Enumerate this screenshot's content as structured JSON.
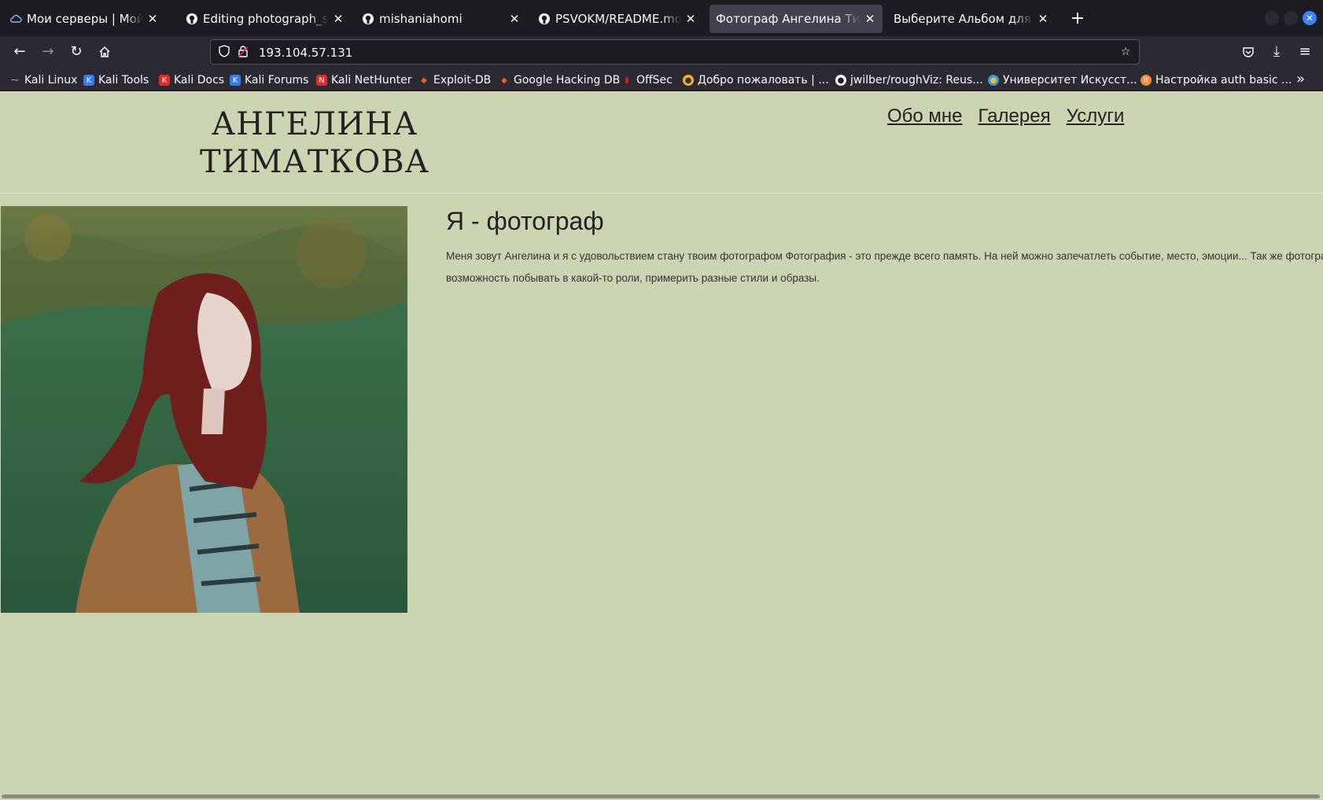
{
  "tabs": [
    {
      "title": "Мои серверы | Мой аккаунт",
      "icon": "cloud-icon"
    },
    {
      "title": "Editing photograph_site/README.md",
      "icon": "github-icon"
    },
    {
      "title": "mishaniahomi",
      "icon": "github-icon"
    },
    {
      "title": "PSVOKM/README.md at main",
      "icon": "github-icon"
    },
    {
      "title": "Фотограф Ангелина Тиматкова",
      "icon": "page-icon",
      "active": true
    },
    {
      "title": "Выберите Альбом для изменения",
      "icon": "page-icon"
    }
  ],
  "address": {
    "url": "193.104.57.131"
  },
  "bookmarks": [
    {
      "label": "Kali Linux",
      "color": "#367bf0"
    },
    {
      "label": "Kali Tools",
      "color": "#367bf0"
    },
    {
      "label": "Kali Docs",
      "color": "#e12b2b"
    },
    {
      "label": "Kali Forums",
      "color": "#367bf0"
    },
    {
      "label": "Kali NetHunter",
      "color": "#e12b2b"
    },
    {
      "label": "Exploit-DB",
      "color": "#e8611f"
    },
    {
      "label": "Google Hacking DB",
      "color": "#e8611f"
    },
    {
      "label": "OffSec",
      "color": "#d02020"
    },
    {
      "label": "Добро пожаловать | ...",
      "color": "#f0b430"
    },
    {
      "label": "jwilber/roughViz: Reus...",
      "color": "#ffffff"
    },
    {
      "label": "Университет Искусст...",
      "color": "#3a9ad9"
    },
    {
      "label": "Настройка auth basic ...",
      "color": "#f08a3a"
    }
  ],
  "site": {
    "logo_line1": "АНГЕЛИНА",
    "logo_line2": "ТИМАТКОВА",
    "menu": [
      "Обо мне",
      "Галерея",
      "Услуги"
    ],
    "about_title": "Я - фотограф",
    "about_text": "Меня зовут Ангелина и я с удовольствием стану твоим фотографом Фотография - это прежде всего память. На ней можно запечатлеть событие, место, эмоции... Так же фотография - это возможность побывать в какой-то роли, примерить разные стили и образы."
  },
  "colors": {
    "page_bg": "#cbd5b1",
    "text": "#222222",
    "browser_dark": "#1c1b22",
    "toolbar": "#2b2a33"
  }
}
